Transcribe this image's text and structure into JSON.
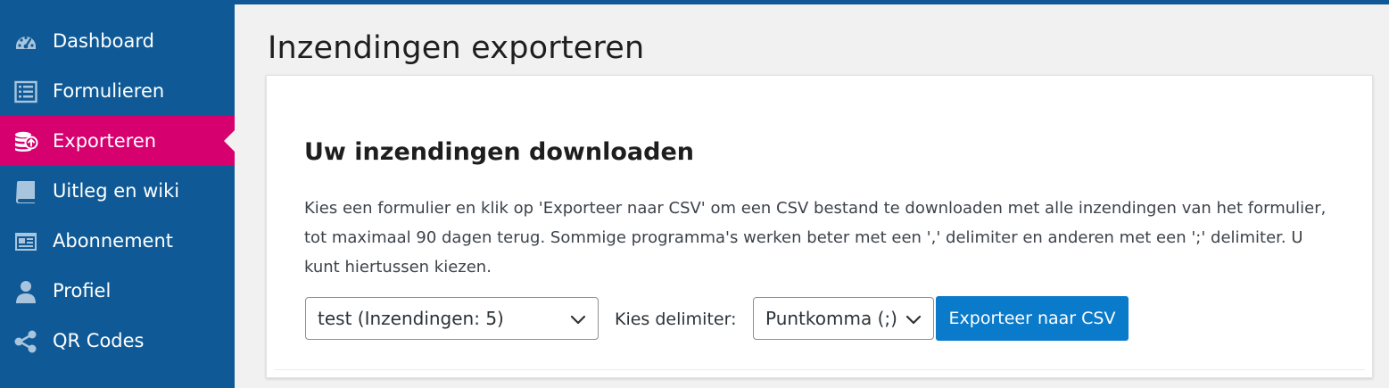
{
  "sidebar": {
    "items": [
      {
        "label": "Dashboard",
        "icon": "dashboard-icon",
        "active": false
      },
      {
        "label": "Formulieren",
        "icon": "list-icon",
        "active": false
      },
      {
        "label": "Exporteren",
        "icon": "database-export-icon",
        "active": true
      },
      {
        "label": "Uitleg en wiki",
        "icon": "book-icon",
        "active": false
      },
      {
        "label": "Abonnement",
        "icon": "subscription-card-icon",
        "active": false
      },
      {
        "label": "Profiel",
        "icon": "user-icon",
        "active": false
      },
      {
        "label": "QR Codes",
        "icon": "share-icon",
        "active": false
      }
    ]
  },
  "page": {
    "title": "Inzendingen exporteren"
  },
  "card": {
    "heading": "Uw inzendingen downloaden",
    "description": "Kies een formulier en klik op 'Exporteer naar CSV' om een CSV bestand te downloaden met alle inzendingen van het formulier, tot maximaal 90 dagen terug. Sommige programma's werken beter met een ',' delimiter en anderen met een ';' delimiter. U kunt hiertussen kiezen.",
    "form_select": {
      "value": "test (Inzendingen: 5)"
    },
    "delimiter_label": "Kies delimiter:",
    "delimiter_select": {
      "value": "Puntkomma (;)"
    },
    "export_button": "Exporteer naar CSV"
  },
  "colors": {
    "sidebar_bg": "#0f5a96",
    "active_item": "#d6006f",
    "primary_button": "#0a7acb",
    "page_bg": "#f1f1f1"
  }
}
